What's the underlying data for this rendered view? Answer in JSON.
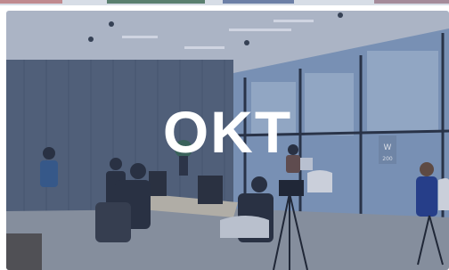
{
  "hero": {
    "logo_text": "OKT",
    "sign_text": "W\n200",
    "colors": {
      "tint": "#3b5a8c",
      "ceiling": "#c9cfd8",
      "wall": "#59677c",
      "window": "#8aa3c4",
      "floor": "#9aa0a8",
      "logo": "#ffffff"
    }
  }
}
